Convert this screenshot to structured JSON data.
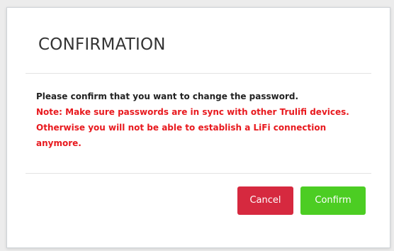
{
  "dialog": {
    "title": "CONFIRMATION",
    "message": "Please confirm that you want to change the password.",
    "note": "Note: Make sure passwords are in sync with other Trulifi devices. Otherwise you will not be able to establish a LiFi connection anymore.",
    "cancel_label": "Cancel",
    "confirm_label": "Confirm"
  },
  "colors": {
    "note_text": "#e8191e",
    "cancel_button": "#d6293f",
    "confirm_button": "#4ccd23"
  }
}
